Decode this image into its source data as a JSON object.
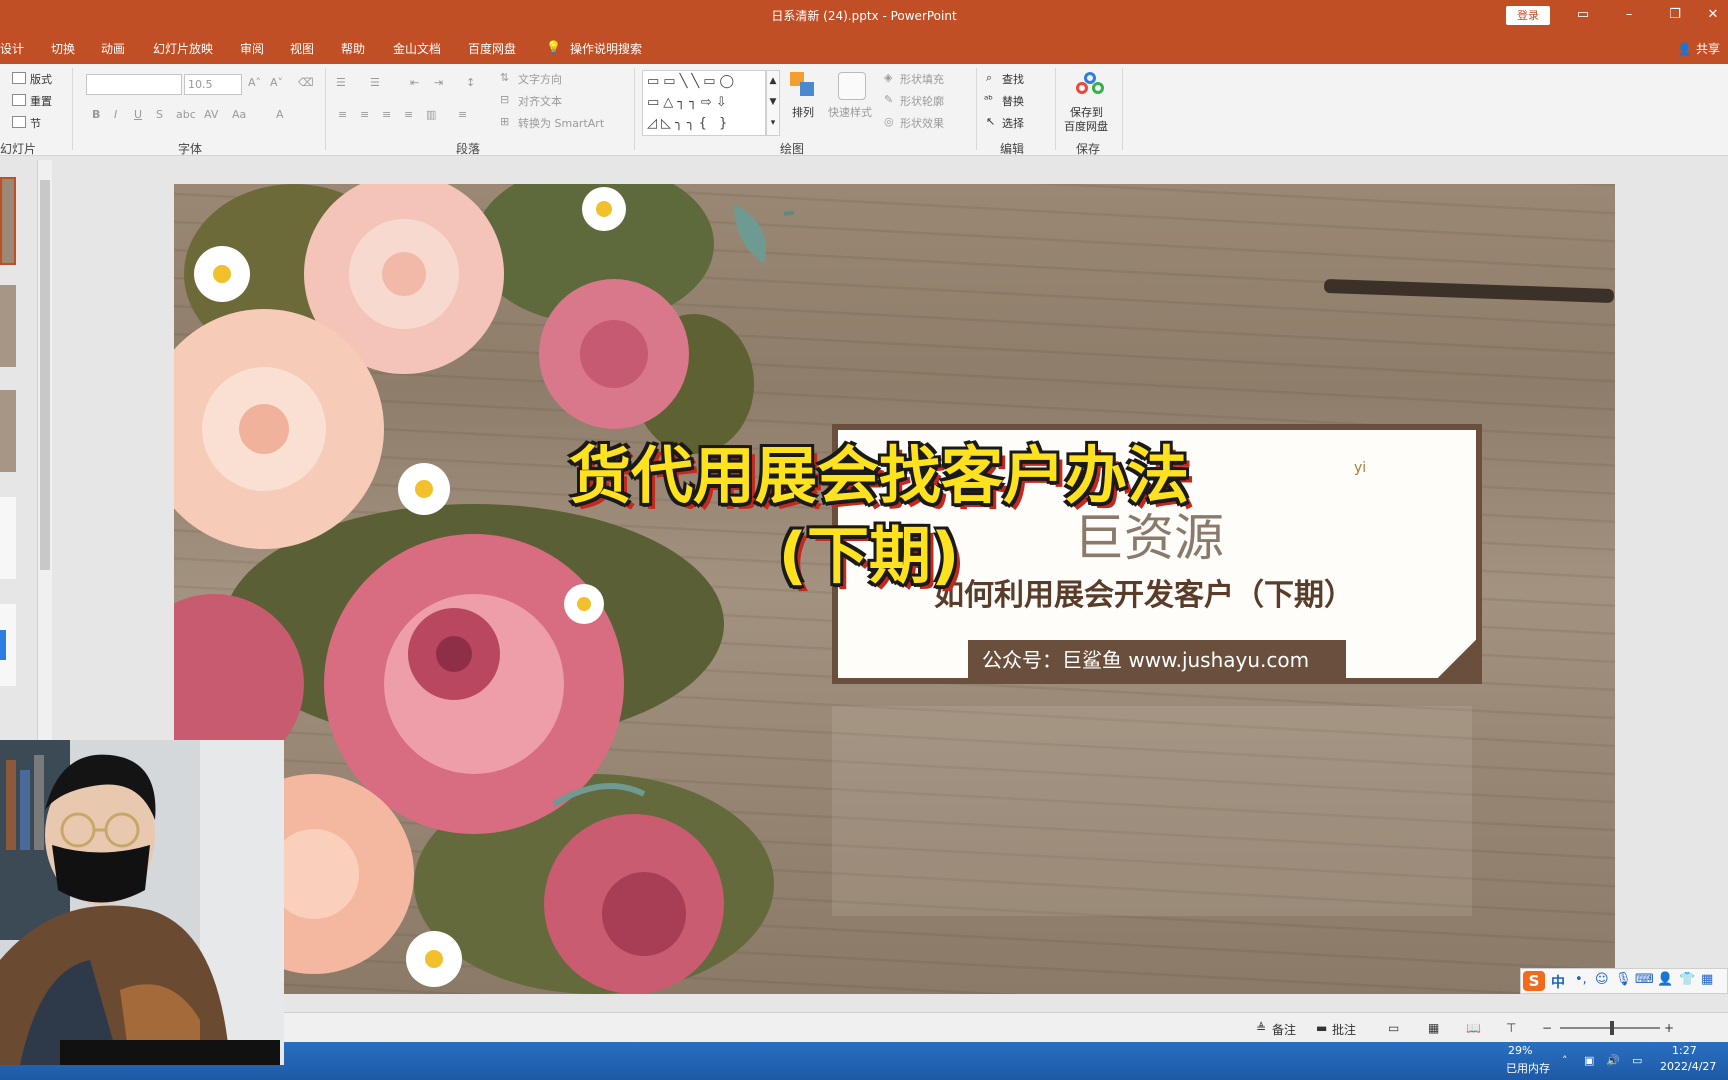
{
  "window": {
    "title": "日系清新 (24).pptx  -  PowerPoint",
    "login_label": "登录",
    "share_label": "共享"
  },
  "tabs": [
    "设计",
    "切换",
    "动画",
    "幻灯片放映",
    "审阅",
    "视图",
    "帮助",
    "金山文档",
    "百度网盘"
  ],
  "tell_me": "操作说明搜索",
  "ribbon": {
    "slides_group": {
      "layout": "版式",
      "reset": "重置",
      "section": "节",
      "label": "幻灯片"
    },
    "font_group": {
      "font_size": "10.5",
      "label": "字体"
    },
    "paragraph_group": {
      "text_direction": "文字方向",
      "align_text": "对齐文本",
      "convert_smartart": "转换为 SmartArt",
      "label": "段落"
    },
    "drawing_group": {
      "arrange": "排列",
      "quick_styles": "快速样式",
      "shape_fill": "形状填充",
      "shape_outline": "形状轮廓",
      "shape_effects": "形状效果",
      "label": "绘图"
    },
    "editing_group": {
      "find": "查找",
      "replace": "替换",
      "select": "选择",
      "label": "编辑"
    },
    "save_group": {
      "save_to_baidu": "保存到",
      "save_to_baidu_2": "百度网盘",
      "label": "保存"
    }
  },
  "slide": {
    "card_pinyin": "yi",
    "card_big_text": "巨资源",
    "card_subtitle": "如何利用展会开发客户（下期）",
    "card_band": "公众号：巨鲨鱼     www.jushayu.com"
  },
  "overlay": {
    "line1": "货代用展会找客户办法",
    "line2": "(下期)"
  },
  "statusbar": {
    "notes": "备注",
    "comments": "批注"
  },
  "taskbar": {
    "memory_percent": "29%",
    "memory_label": "已用内存",
    "time": "1:27",
    "date": "2022/4/27"
  },
  "ime": {
    "logo": "S",
    "mode": "中"
  }
}
